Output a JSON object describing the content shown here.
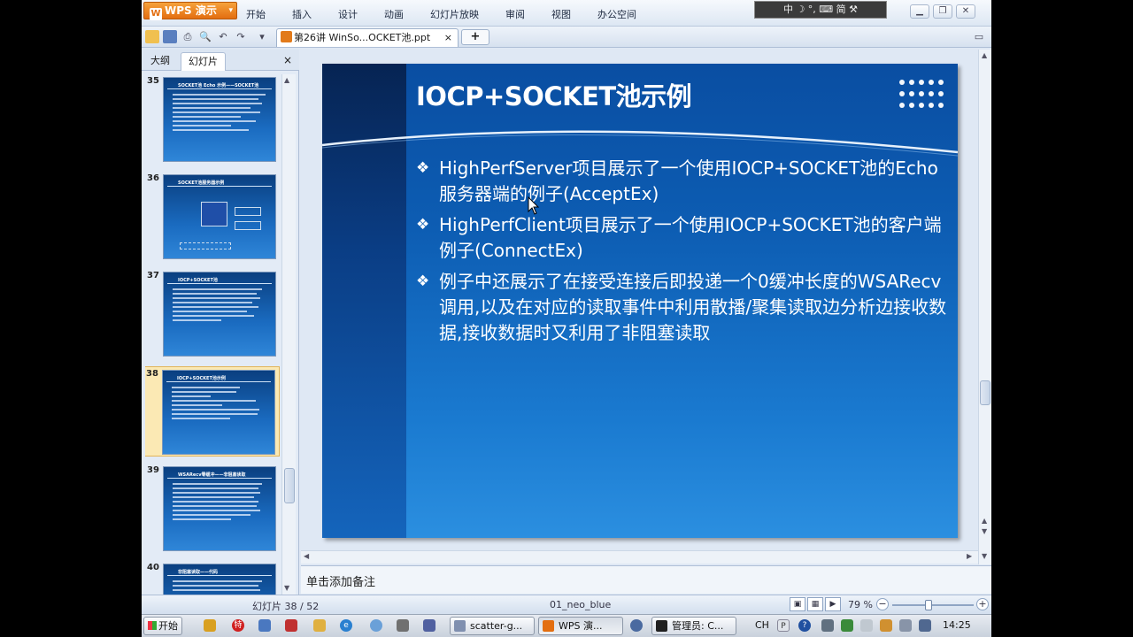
{
  "app": {
    "logo_label": "WPS 演示",
    "menus": [
      "开始",
      "插入",
      "设计",
      "动画",
      "幻灯片放映",
      "审阅",
      "视图",
      "办公空间"
    ],
    "ime_label": "中 ☽ °, ⌨ 简 ⚒"
  },
  "toolbar": {
    "doc_tab_label": "第26讲 WinSo...OCKET池.ppt",
    "doc_tab_close": "×",
    "new_tab_label": "+"
  },
  "left_panel": {
    "tabs": [
      "大纲",
      "幻灯片"
    ],
    "close_label": "×",
    "thumbnails": [
      {
        "number": "35",
        "title": "SOCKET池 Echo 示例——SOCKET池"
      },
      {
        "number": "36",
        "title": "SOCKET池服务器示例"
      },
      {
        "number": "37",
        "title": "IOCP+SOCKET池"
      },
      {
        "number": "38",
        "title": "IOCP+SOCKET池示例"
      },
      {
        "number": "39",
        "title": "WSARecv零缓冲——非阻塞读取"
      },
      {
        "number": "40",
        "title": "非阻塞读取——代码"
      }
    ],
    "selected_index": 3
  },
  "slide": {
    "title": "IOCP+SOCKET池示例",
    "bullet_mark": "❖",
    "bullets": [
      "HighPerfServer项目展示了一个使用IOCP+SOCKET池的Echo服务器端的例子(AcceptEx)",
      "HighPerfClient项目展示了一个使用IOCP+SOCKET池的客户端例子(ConnectEx)",
      "例子中还展示了在接受连接后即投递一个0缓冲长度的WSARecv调用,以及在对应的读取事件中利用散播/聚集读取边分析边接收数据,接收数据时又利用了非阻塞读取"
    ]
  },
  "notes": {
    "placeholder": "单击添加备注"
  },
  "statusbar": {
    "slide_position": "幻灯片 38 / 52",
    "theme": "01_neo_blue",
    "zoom": "79 %",
    "zoom_fraction": 0.45
  },
  "taskbar": {
    "start_label": "开始",
    "tasks": [
      "scatter-g...",
      "WPS 演...",
      "管理员: C..."
    ],
    "lang": "CH",
    "clock": "14:25"
  },
  "colors": {
    "slide_bg": "#0d5db3",
    "slide_text": "#ffffff",
    "wps_orange": "#e36e10",
    "selected_thumb": "#fbe9b4"
  }
}
